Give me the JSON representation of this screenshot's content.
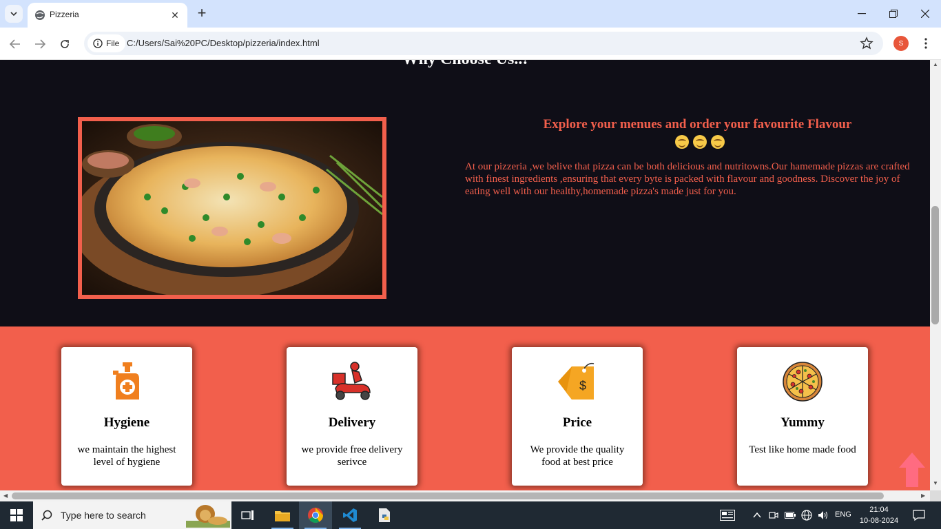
{
  "browser": {
    "tab_title": "Pizzeria",
    "address_scheme": "File",
    "url": "C:/Users/Sai%20PC/Desktop/pizzeria/index.html",
    "profile_initial": "S"
  },
  "page": {
    "section_heading": "Why Choose Us..!",
    "explore_title": "Explore your menues and order your favourite Flavour",
    "explore_text": "At our pizzeria ,we belive that pizza can be both delicious and nutritowns.Our hamemade pizzas are crafted with finest ingredients ,ensuring that every byte is packed with flavour and goodness. Discover the joy of eating well with our healthy,homemade pizza's made just for you.",
    "features": [
      {
        "title": "Hygiene",
        "desc": "we maintain the highest level of hygiene",
        "icon": "sanitizer-bottle-icon"
      },
      {
        "title": "Delivery",
        "desc": "we provide free delivery serivce",
        "icon": "delivery-scooter-icon"
      },
      {
        "title": "Price",
        "desc": "We provide the quality food at best price",
        "icon": "price-tag-icon"
      },
      {
        "title": "Yummy",
        "desc": "Test like home made food",
        "icon": "pizza-icon"
      }
    ],
    "colors": {
      "accent": "#f25f4c",
      "dark_bg": "#0f0e17"
    }
  },
  "taskbar": {
    "search_placeholder": "Type here to search",
    "language": "ENG",
    "time": "21:04",
    "date": "10-08-2024"
  }
}
